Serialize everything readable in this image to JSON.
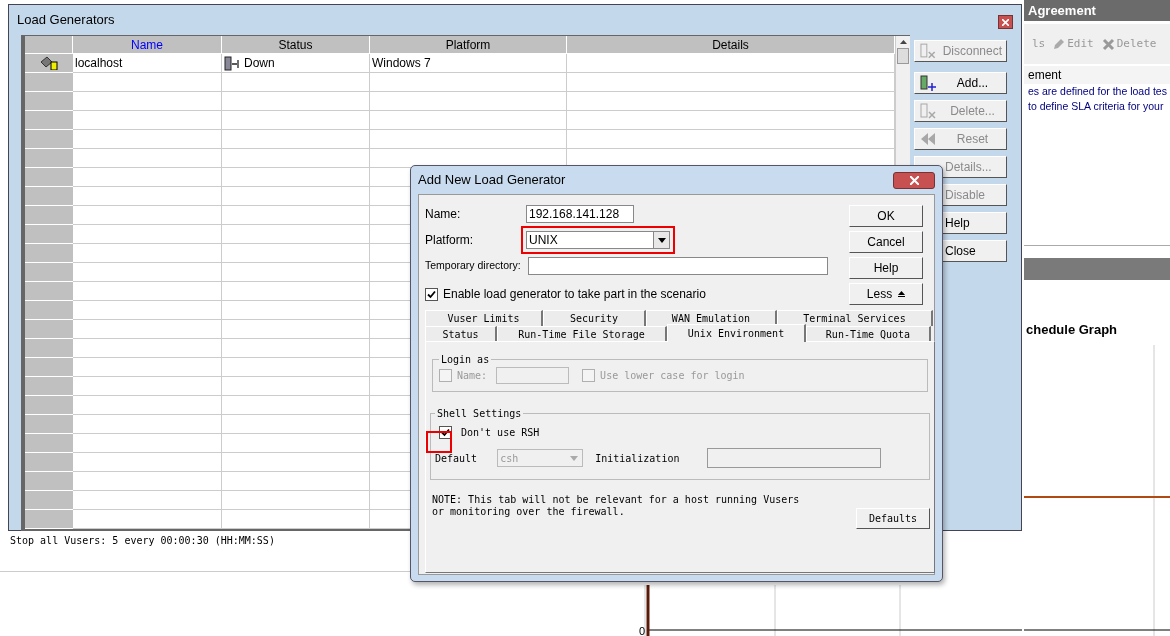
{
  "background": {
    "pane_title": "Agreement",
    "toolbar": [
      {
        "label": "ls",
        "kind": "text"
      },
      {
        "label": "Edit",
        "kind": "edit"
      },
      {
        "label": "Delete",
        "kind": "delete"
      }
    ],
    "section_heading": "ement",
    "lines": [
      "es are defined for the load tes",
      "to define SLA criteria for your"
    ],
    "graph_title": "chedule Graph",
    "axis_label": "0",
    "schedule_text": "Stop all Vusers: 5 every 00:00:30 (HH:MM:SS)"
  },
  "load_generators": {
    "title": "Load Generators",
    "columns": [
      {
        "label": "Name",
        "sorted": true
      },
      {
        "label": "Status",
        "sorted": false
      },
      {
        "label": "Platform",
        "sorted": false
      },
      {
        "label": "Details",
        "sorted": false
      }
    ],
    "rows": [
      {
        "name": "localhost",
        "status": "Down",
        "platform": "Windows 7"
      }
    ],
    "buttons": [
      {
        "label": "Disconnect",
        "kind": "disconnect",
        "disabled": true
      },
      {
        "label": "Add...",
        "kind": "add",
        "disabled": false
      },
      {
        "label": "Delete...",
        "kind": "delete",
        "disabled": true
      },
      {
        "label": "Reset",
        "kind": "reset",
        "disabled": true
      },
      {
        "label": "Details...",
        "kind": "plain",
        "disabled": true
      },
      {
        "label": "Disable",
        "kind": "plain",
        "disabled": true
      },
      {
        "label": "Help",
        "kind": "plain",
        "disabled": false
      },
      {
        "label": "Close",
        "kind": "plain",
        "disabled": false
      }
    ]
  },
  "dialog": {
    "title": "Add New Load Generator",
    "name_label": "Name:",
    "name_value": "192.168.141.128",
    "platform_label": "Platform:",
    "platform_value": "UNIX",
    "temp_dir_label": "Temporary directory:",
    "enable": {
      "label": "Enable load generator to take part in the scenario",
      "checked": true
    },
    "buttons": [
      {
        "label": "OK",
        "kind": "plain"
      },
      {
        "label": "Cancel",
        "kind": "plain"
      },
      {
        "label": "Help",
        "kind": "plain"
      },
      {
        "label": "Less",
        "kind": "less"
      }
    ],
    "tab_rows": [
      [
        {
          "label": "Vuser Limits",
          "selected": false
        },
        {
          "label": "Security",
          "selected": false
        },
        {
          "label": "WAN Emulation",
          "selected": false
        },
        {
          "label": "Terminal Services",
          "selected": false
        }
      ],
      [
        {
          "label": "Status",
          "selected": false
        },
        {
          "label": "Run-Time File Storage",
          "selected": false
        },
        {
          "label": "Unix Environment",
          "selected": true
        },
        {
          "label": "Run-Time Quota",
          "selected": false
        }
      ]
    ],
    "login": {
      "title": "Login as",
      "name": {
        "label": "Name:",
        "checked": false,
        "disabled": true
      },
      "lower_case": {
        "label": "Use lower case for login",
        "checked": false,
        "disabled": true
      }
    },
    "shell": {
      "title": "Shell Settings",
      "dont_use_rsh": {
        "label": "Don't use RSH",
        "checked": true
      },
      "default_label": "Default",
      "default_value": "csh",
      "init_label": "Initialization"
    },
    "note": "NOTE: This tab will not be relevant for a host running Vusers\nor monitoring over the firewall.",
    "defaults_button": "Defaults"
  }
}
